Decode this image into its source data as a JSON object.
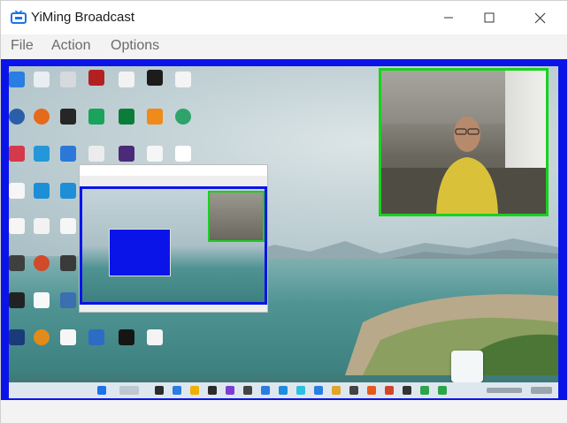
{
  "window": {
    "title": "YiMing Broadcast"
  },
  "menu": {
    "file": "File",
    "action": "Action",
    "options": "Options"
  },
  "colors": {
    "preview_border": "#0a14e8",
    "webcam_border": "#19d11e",
    "app_icon": "#1a73e8"
  },
  "icons": {
    "app": "tv-icon",
    "minimize": "minimize-icon",
    "maximize": "maximize-icon",
    "close": "close-icon"
  }
}
